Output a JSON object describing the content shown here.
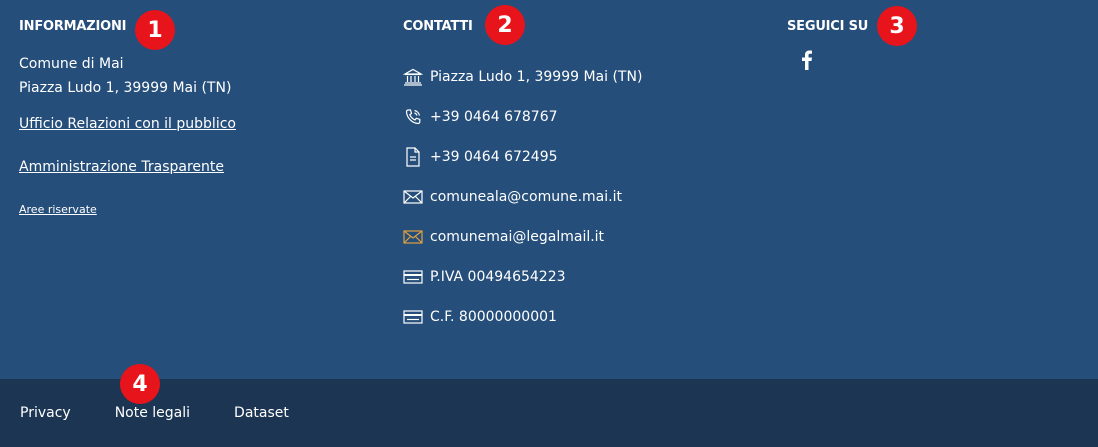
{
  "info": {
    "title": "INFORMAZIONI",
    "name": "Comune di Mai",
    "address": "Piazza Ludo 1, 39999 Mai (TN)",
    "links": [
      "Ufficio Relazioni con il pubblico",
      "Amministrazione Trasparente"
    ],
    "small_link": "Aree riservate"
  },
  "contacts": {
    "title": "CONTATTI",
    "items": [
      {
        "icon": "building-icon",
        "text": "Piazza Ludo 1, 39999 Mai (TN)"
      },
      {
        "icon": "phone-icon",
        "text": "+39 0464 678767"
      },
      {
        "icon": "fax-icon",
        "text": "+39 0464 672495"
      },
      {
        "icon": "mail-icon",
        "text": "comuneala@comune.mai.it"
      },
      {
        "icon": "pec-mail-icon",
        "text": "comunemai@legalmail.it"
      },
      {
        "icon": "card-icon",
        "text": "P.IVA 00494654223"
      },
      {
        "icon": "card-icon",
        "text": "C.F. 80000000001"
      }
    ]
  },
  "social": {
    "title": "SEGUICI SU",
    "networks": [
      {
        "icon": "facebook-icon"
      }
    ]
  },
  "bottom_nav": [
    "Privacy",
    "Note legali",
    "Dataset"
  ],
  "badges": [
    "1",
    "2",
    "3",
    "4"
  ],
  "colors": {
    "footer_bg": "#254e7a",
    "bottom_bg": "#1b3552",
    "badge": "#e8141b",
    "pec_icon": "#e0a040"
  }
}
